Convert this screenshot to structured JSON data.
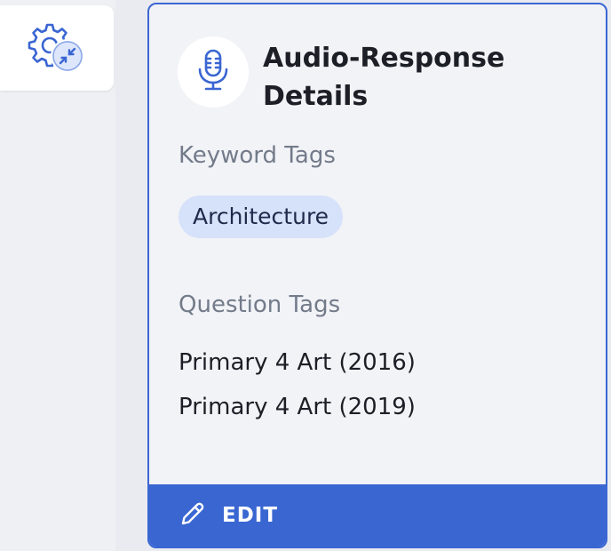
{
  "sidebar": {
    "settings_button_icon": "settings-collapse-icon"
  },
  "card": {
    "title": "Audio-Response Details",
    "header_icon": "microphone-icon",
    "keyword_tags_label": "Keyword Tags",
    "keyword_tags": [
      "Architecture"
    ],
    "question_tags_label": "Question Tags",
    "question_tags": [
      "Primary 4 Art (2016)",
      "Primary 4 Art (2019)"
    ],
    "edit_label": "EDIT",
    "edit_icon": "pencil-icon"
  },
  "colors": {
    "accent": "#3a66d2",
    "chip_bg": "#d6e1fa",
    "card_bg": "#f2f3f7",
    "label_gray": "#737b8a"
  }
}
